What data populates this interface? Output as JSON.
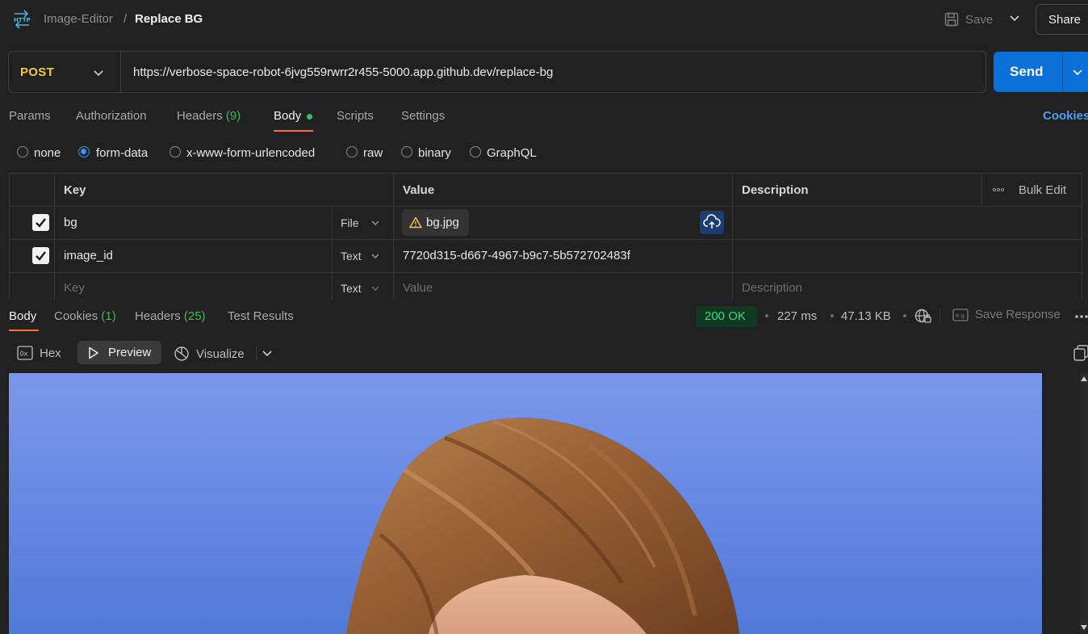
{
  "header": {
    "collection": "Image-Editor",
    "separator": "/",
    "request_name": "Replace BG",
    "save_label": "Save",
    "share_label": "Share"
  },
  "request": {
    "method": "POST",
    "url": "https://verbose-space-robot-6jvg559rwrr2r455-5000.app.github.dev/replace-bg",
    "send_label": "Send"
  },
  "req_tabs": {
    "params": "Params",
    "authorization": "Authorization",
    "headers": "Headers",
    "headers_count": "(9)",
    "body": "Body",
    "scripts": "Scripts",
    "settings": "Settings",
    "cookies": "Cookies"
  },
  "body_types": {
    "none": "none",
    "form_data": "form-data",
    "urlencoded": "x-www-form-urlencoded",
    "raw": "raw",
    "binary": "binary",
    "graphql": "GraphQL",
    "selected": "form-data"
  },
  "table": {
    "headers": {
      "key": "Key",
      "value": "Value",
      "description": "Description",
      "bulk_edit": "Bulk Edit"
    },
    "rows": [
      {
        "key": "bg",
        "type": "File",
        "value": "bg.jpg",
        "checked": true
      },
      {
        "key": "image_id",
        "type": "Text",
        "value": "7720d315-d667-4967-b9c7-5b572702483f",
        "checked": true
      }
    ],
    "placeholder": {
      "key": "Key",
      "type": "Text",
      "value": "Value",
      "description": "Description"
    }
  },
  "response": {
    "tabs": {
      "body": "Body",
      "cookies": "Cookies",
      "cookies_count": "(1)",
      "headers": "Headers",
      "headers_count": "(25)",
      "test_results": "Test Results"
    },
    "status": "200 OK",
    "time": "227 ms",
    "size": "47.13 KB",
    "save_response": "Save Response",
    "views": {
      "hex": "Hex",
      "preview": "Preview",
      "visualize": "Visualize"
    }
  },
  "colors": {
    "accent": "#ff6c37",
    "send": "#0a6fd6",
    "method": "#f2c94c",
    "status_ok": "#3fd37e",
    "link": "#4c9cf0"
  }
}
